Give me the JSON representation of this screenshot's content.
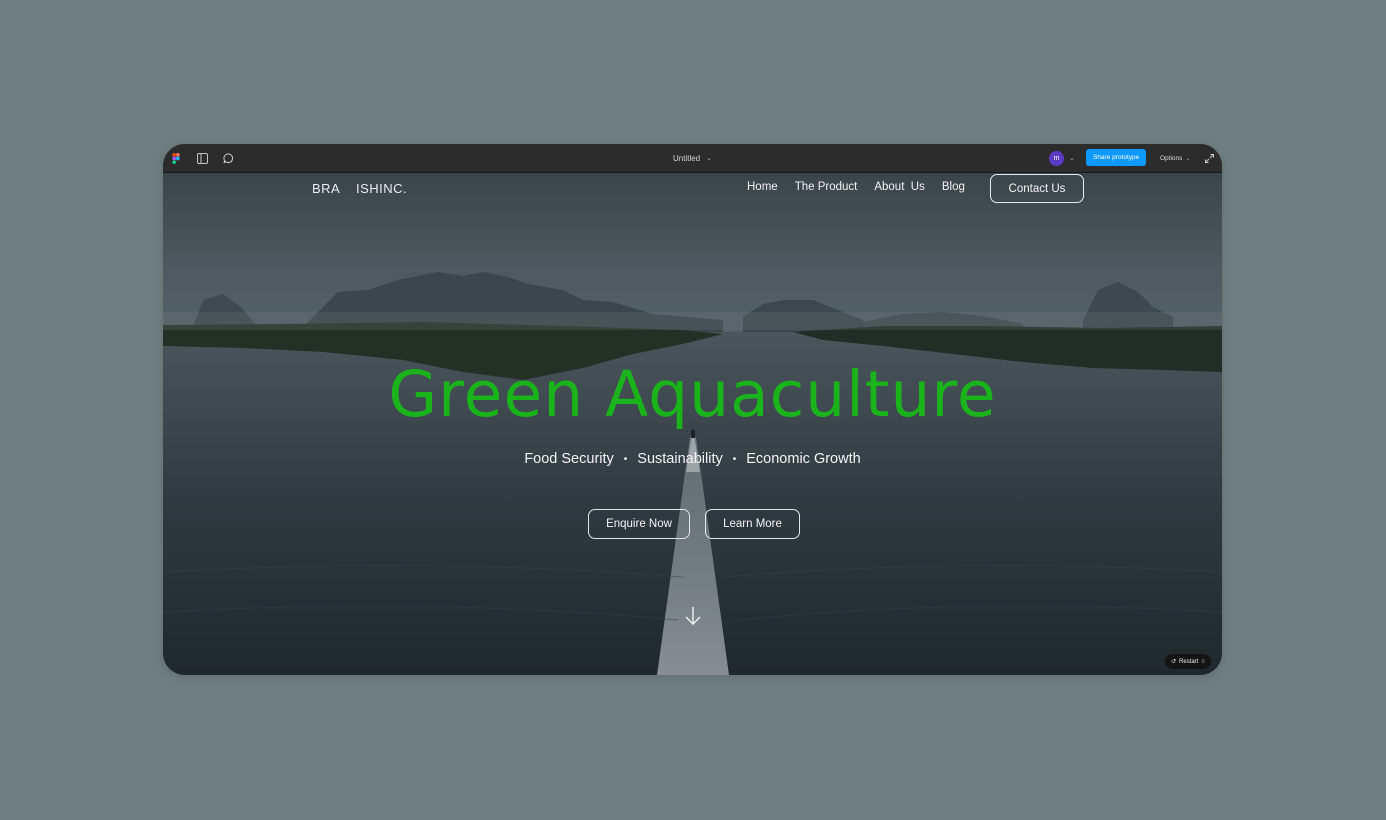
{
  "toolbar": {
    "doc_title": "Untitled",
    "avatar_initial": "m",
    "share_label": "Share prototype",
    "options_label": "Options"
  },
  "site": {
    "logo": "BRA    ISHINC.",
    "nav": [
      {
        "label": "Home"
      },
      {
        "label": "The Product"
      },
      {
        "label": "About  Us"
      },
      {
        "label": "Blog"
      }
    ],
    "contact_label": "Contact Us"
  },
  "hero": {
    "title": "Green Aquaculture",
    "tagline": [
      "Food Security",
      "Sustainability",
      "Economic Growth"
    ],
    "separator": "•",
    "enquire_label": "Enquire Now",
    "learn_label": "Learn More"
  },
  "player": {
    "restart_label": "Restart"
  },
  "colors": {
    "page_bg": "#6f7f80",
    "accent_green": "#1bb31b",
    "share_blue": "#0d99ff",
    "toolbar_bg": "#2c2c2c"
  }
}
